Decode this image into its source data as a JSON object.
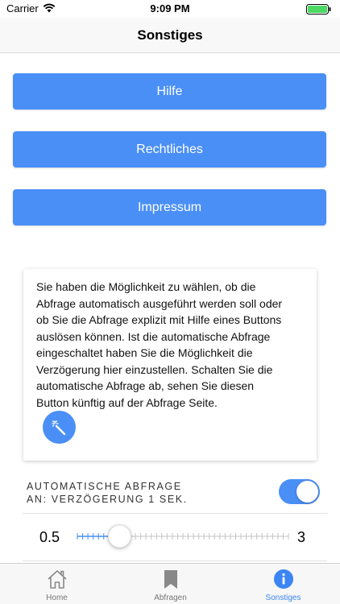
{
  "status_bar": {
    "carrier": "Carrier",
    "time": "9:09 PM"
  },
  "nav": {
    "title": "Sonstiges"
  },
  "buttons": {
    "hilfe": "Hilfe",
    "rechtliches": "Rechtliches",
    "impressum": "Impressum"
  },
  "info_card": {
    "lines": [
      "Sie haben die Möglichkeit zu wählen, ob die",
      "Abfrage automatisch ausgeführt werden soll oder",
      "ob Sie die Abfrage explizit mit Hilfe eines Buttons",
      "auslösen können. Ist die automatische Abfrage",
      "eingeschaltet haben Sie die Möglichkeit die",
      "Verzögerung hier einzustellen. Schalten Sie die",
      "automatische Abfrage ab, sehen Sie diesen",
      "Button künftig auf der Abfrage Seite."
    ],
    "button_icon": "magic-wand-icon"
  },
  "auto_query": {
    "label_line1": "AUTOMATISCHE ABFRAGE",
    "label_line2": "AN: VERZÖGERUNG 1 SEK.",
    "enabled": true
  },
  "delay_slider": {
    "min_label": "0.5",
    "max_label": "3",
    "min": 0.5,
    "max": 3,
    "value": 1
  },
  "tabs": [
    {
      "label": "Home",
      "icon": "home-icon",
      "active": false
    },
    {
      "label": "Abfragen",
      "icon": "bookmark-icon",
      "active": false
    },
    {
      "label": "Sonstiges",
      "icon": "info-icon",
      "active": true
    }
  ],
  "colors": {
    "accent": "#4a8ff6",
    "battery": "#4cd964",
    "tab_inactive": "#777777"
  }
}
